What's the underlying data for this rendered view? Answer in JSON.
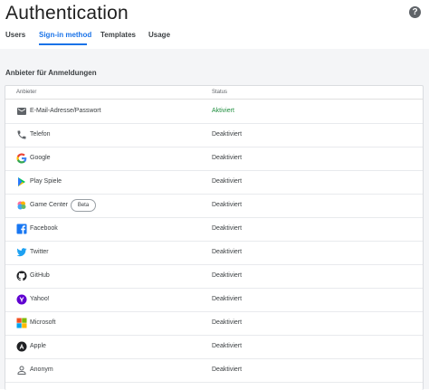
{
  "header": {
    "title": "Authentication"
  },
  "tabs": [
    {
      "label": "Users"
    },
    {
      "label": "Sign-in method"
    },
    {
      "label": "Templates"
    },
    {
      "label": "Usage"
    }
  ],
  "section": {
    "title": "Anbieter für Anmeldungen"
  },
  "table": {
    "columns": [
      "Anbieter",
      "Status"
    ],
    "rows": [
      {
        "name": "E-Mail-Adresse/Passwort",
        "status": "Aktiviert",
        "icon": "email-icon"
      },
      {
        "name": "Telefon",
        "status": "Deaktiviert",
        "icon": "phone-icon"
      },
      {
        "name": "Google",
        "status": "Deaktiviert",
        "icon": "google-icon"
      },
      {
        "name": "Play Spiele",
        "status": "Deaktiviert",
        "icon": "play-games-icon"
      },
      {
        "name": "Game Center",
        "status": "Deaktiviert",
        "icon": "game-center-icon",
        "badge": "Beta"
      },
      {
        "name": "Facebook",
        "status": "Deaktiviert",
        "icon": "facebook-icon"
      },
      {
        "name": "Twitter",
        "status": "Deaktiviert",
        "icon": "twitter-icon"
      },
      {
        "name": "GitHub",
        "status": "Deaktiviert",
        "icon": "github-icon"
      },
      {
        "name": "Yahoo!",
        "status": "Deaktiviert",
        "icon": "yahoo-icon"
      },
      {
        "name": "Microsoft",
        "status": "Deaktiviert",
        "icon": "microsoft-icon"
      },
      {
        "name": "Apple",
        "status": "Deaktiviert",
        "icon": "apple-icon"
      },
      {
        "name": "Anonym",
        "status": "Deaktiviert",
        "icon": "anonymous-icon"
      }
    ]
  },
  "colors": {
    "accent": "#1a73e8",
    "enabled": "#1e8e3e",
    "background": "#f4f5f7"
  }
}
